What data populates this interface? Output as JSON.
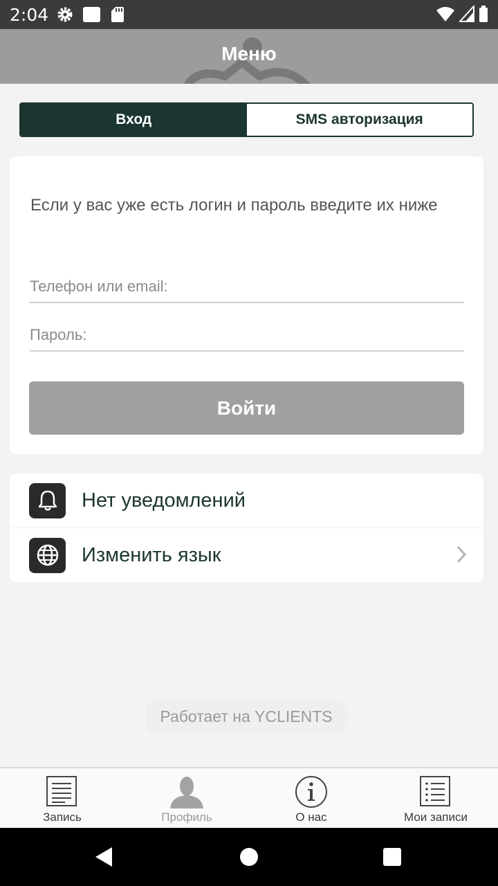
{
  "status_bar": {
    "time": "2:04",
    "icons": [
      "settings-icon",
      "notification-square-icon",
      "sd-card-icon",
      "wifi-icon",
      "signal-icon",
      "battery-icon"
    ]
  },
  "header": {
    "title": "Меню"
  },
  "tabs": [
    {
      "label": "Вход",
      "active": true
    },
    {
      "label": "SMS авторизация",
      "active": false
    }
  ],
  "login": {
    "hint": "Если у вас уже есть логин и пароль введите их ниже",
    "phone_placeholder": "Телефон или email:",
    "password_placeholder": "Пароль:",
    "submit_label": "Войти"
  },
  "menu": {
    "notifications_label": "Нет уведомлений",
    "language_label": "Изменить язык"
  },
  "powered_by": "Работает на YCLIENTS",
  "tabbar": [
    {
      "label": "Запись",
      "icon": "document-icon",
      "dim": false
    },
    {
      "label": "Профиль",
      "icon": "profile-icon",
      "dim": true
    },
    {
      "label": "О нас",
      "icon": "info-icon",
      "dim": false
    },
    {
      "label": "Мои записи",
      "icon": "list-icon",
      "dim": false
    }
  ],
  "colors": {
    "accent": "#1b3530",
    "header_bg": "#9c9c9c",
    "button_disabled": "#a0a0a0",
    "page_bg": "#f3f3f3"
  }
}
